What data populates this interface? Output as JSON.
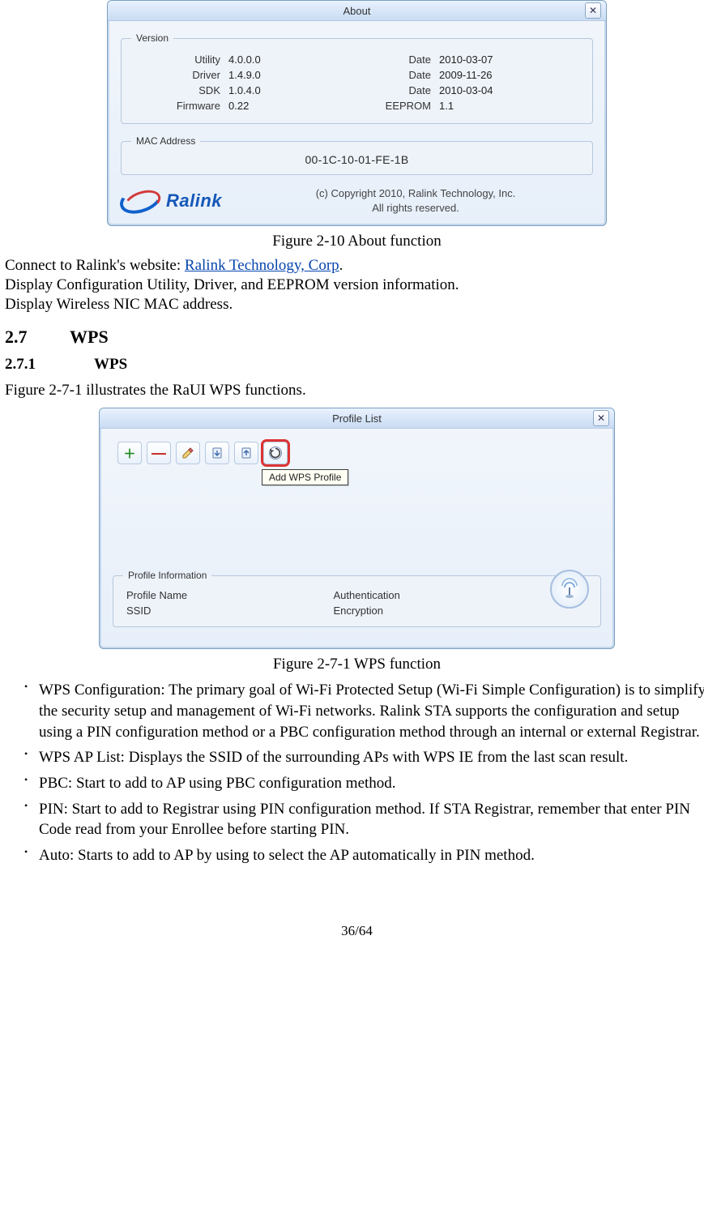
{
  "about": {
    "title": "About",
    "version_group_label": "Version",
    "rows": [
      {
        "l1": "Utility",
        "v1": "4.0.0.0",
        "l2": "Date",
        "v2": "2010-03-07"
      },
      {
        "l1": "Driver",
        "v1": "1.4.9.0",
        "l2": "Date",
        "v2": "2009-11-26"
      },
      {
        "l1": "SDK",
        "v1": "1.0.4.0",
        "l2": "Date",
        "v2": "2010-03-04"
      },
      {
        "l1": "Firmware",
        "v1": "0.22",
        "l2": "EEPROM",
        "v2": "1.1"
      }
    ],
    "mac_group_label": "MAC Address",
    "mac_value": "00-1C-10-01-FE-1B",
    "logo_text": "Ralink",
    "copyright_line1": "(c) Copyright 2010, Ralink Technology, Inc.",
    "copyright_line2": "All rights reserved."
  },
  "captions": {
    "about": "Figure 2-10 About function",
    "wps": "Figure 2-7-1 WPS function"
  },
  "body": {
    "connect_prefix": "Connect to Ralink's website: ",
    "connect_link": "Ralink Technology, Corp",
    "connect_suffix": ".",
    "line2": "Display Configuration Utility, Driver, and EEPROM version information.",
    "line3": "Display Wireless NIC MAC address."
  },
  "sec27": {
    "num": "2.7",
    "title": "WPS"
  },
  "sec271": {
    "num": "2.7.1",
    "title": "WPS"
  },
  "intro271": "Figure 2-7-1 illustrates the RaUI WPS functions.",
  "profile": {
    "title": "Profile List",
    "tooltip": "Add WPS Profile",
    "info_group_label": "Profile Information",
    "info_rows": [
      {
        "left": "Profile Name",
        "right": "Authentication"
      },
      {
        "left": "SSID",
        "right": "Encryption"
      }
    ]
  },
  "bullets": [
    "WPS Configuration: The primary goal of Wi-Fi Protected Setup (Wi-Fi Simple Configuration) is to simplify the security setup and management of Wi-Fi networks. Ralink STA supports the configuration and setup using a PIN configuration method or a PBC configuration method through an internal or external Registrar.",
    "WPS AP List: Displays the SSID of the surrounding APs with WPS IE from the last scan result.",
    "PBC: Start to add to AP using PBC configuration method.",
    "PIN: Start to add to Registrar using PIN configuration method. If STA Registrar, remember that enter PIN Code read from your Enrollee before starting PIN.",
    "Auto: Starts to add to AP by using to select the AP automatically in PIN method."
  ],
  "pagenum": "36/64"
}
